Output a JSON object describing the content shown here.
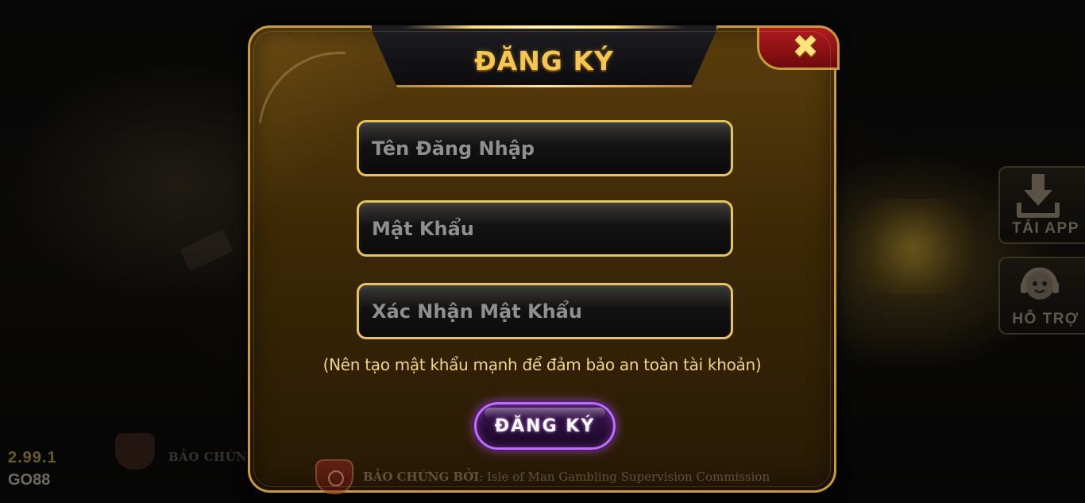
{
  "background": {
    "badge_text": "BẢO CHỨN",
    "version": "2.99.1",
    "brand": "GO88"
  },
  "side_buttons": [
    {
      "label": "TẢI APP",
      "icon": "download-icon"
    },
    {
      "label": "HỖ TRỢ",
      "icon": "support-headset-icon"
    }
  ],
  "modal": {
    "title": "ĐĂNG KÝ",
    "close_icon": "close-icon",
    "fields": {
      "username": {
        "placeholder": "Tên Đăng Nhập",
        "value": ""
      },
      "password": {
        "placeholder": "Mật Khẩu",
        "value": ""
      },
      "confirm_password": {
        "placeholder": "Xác Nhận Mật Khẩu",
        "value": ""
      }
    },
    "hint": "(Nên tạo mật khẩu mạnh để đảm bảo an toàn tài khoản)",
    "submit_label": "ĐĂNG KÝ",
    "footer": {
      "prefix": "BẢO CHỨNG BỞI",
      "body": ": Isle of Man Gambling Supervision Commission"
    }
  },
  "colors": {
    "gold": "#f6c652",
    "accent_purple": "#c26cff",
    "close_red": "#b01b1e"
  }
}
